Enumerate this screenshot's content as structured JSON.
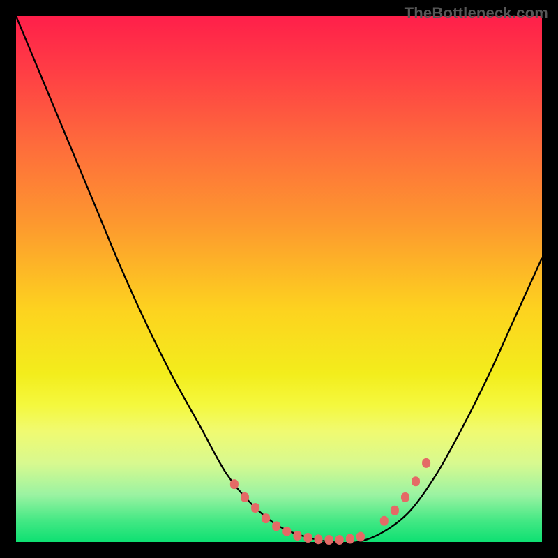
{
  "watermark": "TheBottleneck.com",
  "colors": {
    "frame": "#000000",
    "curve": "#000000",
    "markers": "#e46a66",
    "gradient_stops": [
      "#ff1f4a",
      "#ff3c45",
      "#fe6a3c",
      "#fd9a2e",
      "#fdd31f",
      "#f3ed1c",
      "#f4f83e",
      "#f0fa71",
      "#d8f98f",
      "#9bf3a2",
      "#43e884",
      "#0ee072"
    ]
  },
  "chart_data": {
    "type": "line",
    "title": "",
    "xlabel": "",
    "ylabel": "",
    "x": [
      0.0,
      0.05,
      0.1,
      0.15,
      0.2,
      0.25,
      0.3,
      0.35,
      0.4,
      0.45,
      0.5,
      0.55,
      0.6,
      0.65,
      0.7,
      0.75,
      0.8,
      0.85,
      0.9,
      0.95,
      1.0
    ],
    "values": [
      1.0,
      0.88,
      0.76,
      0.64,
      0.52,
      0.41,
      0.31,
      0.22,
      0.13,
      0.07,
      0.03,
      0.01,
      0.0,
      0.0,
      0.02,
      0.06,
      0.13,
      0.22,
      0.32,
      0.43,
      0.54
    ],
    "xlim": [
      0,
      1
    ],
    "ylim": [
      0,
      1
    ],
    "markers": {
      "x": [
        0.415,
        0.435,
        0.455,
        0.475,
        0.495,
        0.515,
        0.535,
        0.555,
        0.575,
        0.595,
        0.615,
        0.635,
        0.655,
        0.7,
        0.72,
        0.74,
        0.76,
        0.78
      ],
      "y": [
        0.11,
        0.085,
        0.065,
        0.045,
        0.03,
        0.02,
        0.012,
        0.008,
        0.005,
        0.004,
        0.004,
        0.006,
        0.01,
        0.04,
        0.06,
        0.085,
        0.115,
        0.15
      ]
    }
  }
}
